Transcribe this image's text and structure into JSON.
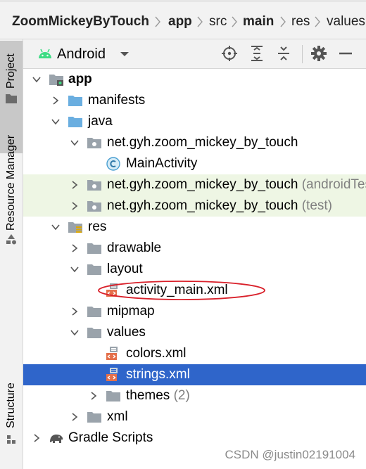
{
  "breadcrumb": {
    "items": [
      {
        "label": "ZoomMickeyByTouch",
        "bold": true
      },
      {
        "label": "app",
        "bold": true
      },
      {
        "label": "src",
        "bold": false
      },
      {
        "label": "main",
        "bold": true
      },
      {
        "label": "res",
        "bold": false
      },
      {
        "label": "values",
        "bold": false
      }
    ]
  },
  "side_tabs": {
    "project": "Project",
    "resource_manager": "Resource Manager",
    "structure": "Structure"
  },
  "project_header": {
    "view_mode": "Android",
    "icons": [
      "locate-icon",
      "expand-all-icon",
      "collapse-all-icon",
      "gear-icon",
      "hide-icon"
    ]
  },
  "tree": {
    "app": "app",
    "manifests": "manifests",
    "java": "java",
    "package_main": "net.gyh.zoom_mickey_by_touch",
    "main_activity": "MainActivity",
    "package_android_test": "net.gyh.zoom_mickey_by_touch",
    "package_android_test_suffix": "(androidTest)",
    "package_test": "net.gyh.zoom_mickey_by_touch",
    "package_test_suffix": "(test)",
    "res": "res",
    "drawable": "drawable",
    "layout": "layout",
    "activity_main": "activity_main.xml",
    "mipmap": "mipmap",
    "values": "values",
    "colors": "colors.xml",
    "strings": "strings.xml",
    "themes": "themes",
    "themes_count": "(2)",
    "xml": "xml",
    "gradle_scripts": "Gradle Scripts"
  },
  "selected_item": "strings.xml",
  "annotation": {
    "shape": "ellipse",
    "color": "#d9202a",
    "target": "activity_main.xml"
  },
  "watermark": "CSDN @justin02191004",
  "colors": {
    "selection": "#2f65ca",
    "test_source_highlight": "#eef6e4",
    "folder_blue": "#6aaee0",
    "folder_gray": "#9aa3ab",
    "android_green": "#3ddc84"
  }
}
